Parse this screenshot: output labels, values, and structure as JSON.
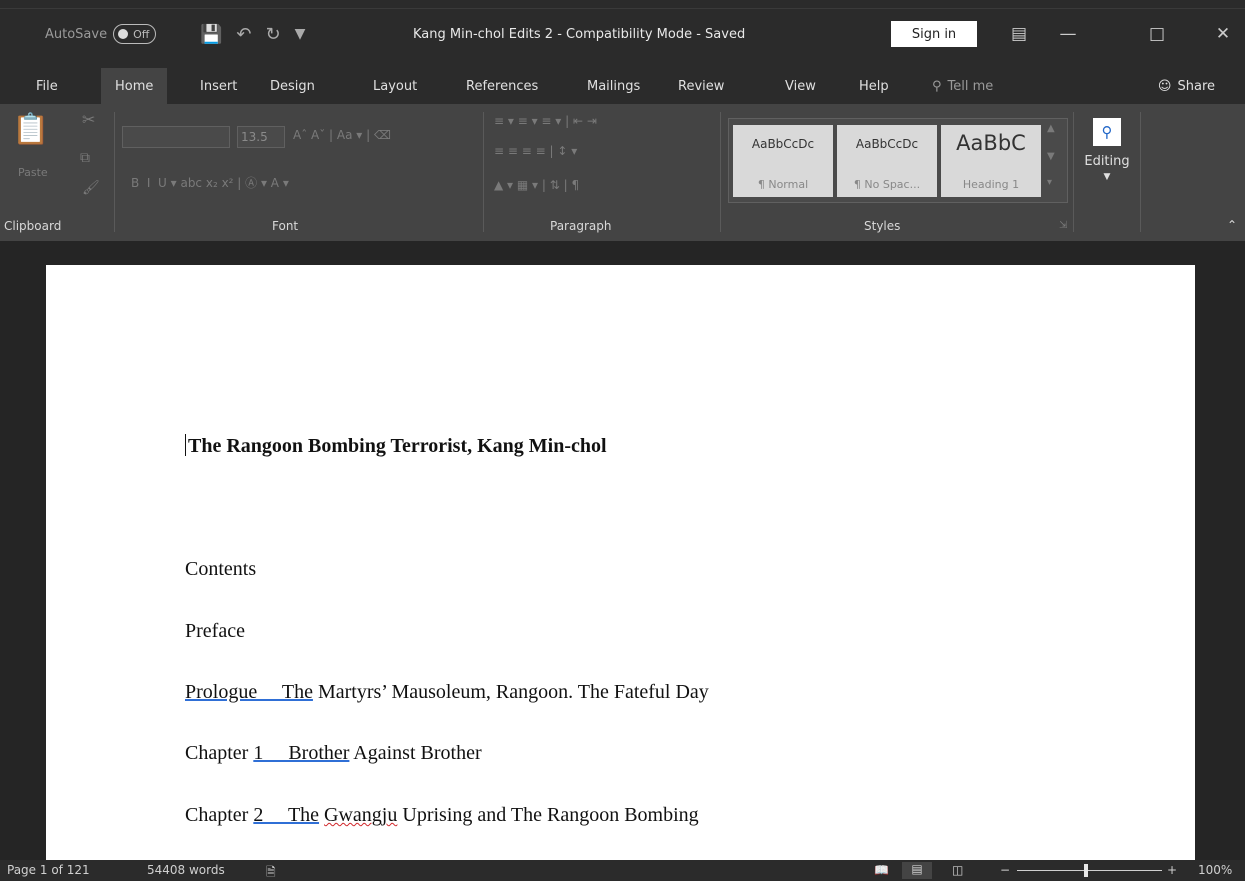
{
  "titlebar": {
    "autosave_label": "AutoSave",
    "autosave_state": "Off",
    "document_title": "Kang Min-chol Edits 2  -  Compatibility Mode  -  Saved",
    "sign_in_label": "Sign in"
  },
  "tabs": [
    "File",
    "Home",
    "Insert",
    "Design",
    "Layout",
    "References",
    "Mailings",
    "Review",
    "View",
    "Help"
  ],
  "active_tab": "Home",
  "tell_me_placeholder": "Tell me",
  "share_label": "Share",
  "ribbon": {
    "clipboard": {
      "label": "Clipboard",
      "paste_label": "Paste"
    },
    "font": {
      "label": "Font",
      "font_size": "13.5"
    },
    "paragraph": {
      "label": "Paragraph"
    },
    "styles": {
      "label": "Styles",
      "tiles": [
        {
          "sample": "AaBbCcDc",
          "name": "¶ Normal"
        },
        {
          "sample": "AaBbCcDc",
          "name": "¶ No Spac..."
        },
        {
          "sample": "AaBbC",
          "name": "Heading 1"
        }
      ]
    },
    "editing": {
      "label": "Editing"
    }
  },
  "document": {
    "title": "The Rangoon Bombing Terrorist, Kang Min-chol",
    "contents": "Contents",
    "preface": "Preface",
    "prologue": {
      "link": "Prologue     The",
      "rest": " Martyrs’ Mausoleum, Rangoon. The Fateful Day"
    },
    "chapter1": {
      "pre": "Chapter ",
      "link": "1     Brother",
      "rest": " Against Brother"
    },
    "chapter2": {
      "pre": "Chapter ",
      "link": "2     The",
      "mid": " ",
      "squig": "Gwangju",
      "rest": " Uprising and The Rangoon Bombing"
    }
  },
  "statusbar": {
    "page": "Page 1 of 121",
    "words": "54408 words",
    "zoom": "100%"
  }
}
